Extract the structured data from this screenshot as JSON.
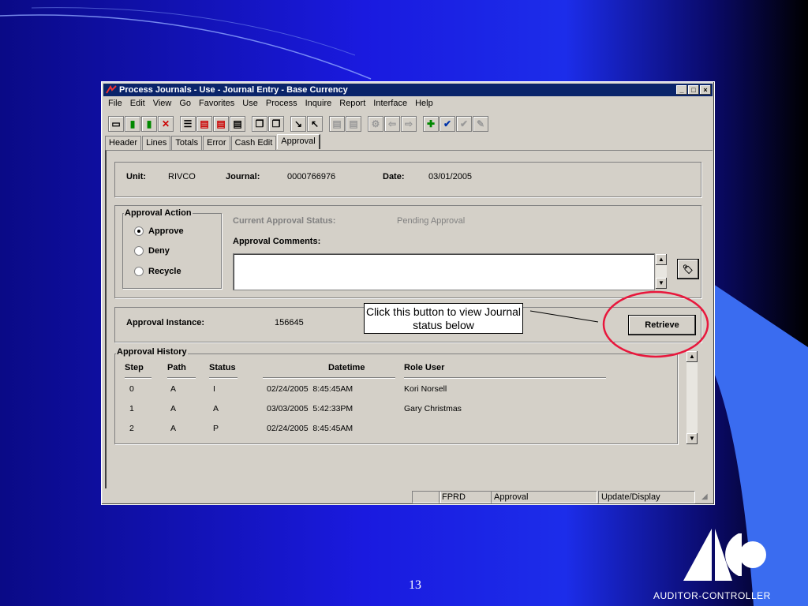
{
  "window": {
    "title": "Process Journals - Use - Journal Entry - Base Currency",
    "controls": [
      "_",
      "□",
      "×"
    ]
  },
  "menu": [
    "File",
    "Edit",
    "View",
    "Go",
    "Favorites",
    "Use",
    "Process",
    "Inquire",
    "Report",
    "Interface",
    "Help"
  ],
  "toolbar_icons": [
    "save-icon",
    "traffic-light-icon",
    "traffic-light-alert-icon",
    "delete-icon",
    "list-icon",
    "insert-row-icon",
    "insert-row-2-icon",
    "page-icon",
    "copy-icon",
    "copy-2-icon",
    "arrow-down-right-icon",
    "arrow-up-left-icon",
    "line-add-icon",
    "line-remove-icon",
    "settings-icon",
    "back-icon",
    "forward-icon",
    "add-icon",
    "check-icon",
    "check-plus-icon",
    "edit-icon"
  ],
  "tabs": [
    "Header",
    "Lines",
    "Totals",
    "Error",
    "Cash Edit",
    "Approval"
  ],
  "active_tab": "Approval",
  "journal": {
    "unit_label": "Unit:",
    "unit_value": "RIVCO",
    "journal_label": "Journal:",
    "journal_value": "0000766976",
    "date_label": "Date:",
    "date_value": "03/01/2005"
  },
  "approval_action": {
    "title": "Approval Action",
    "options": [
      "Approve",
      "Deny",
      "Recycle"
    ],
    "selected": "Approve",
    "status_label": "Current Approval Status:",
    "status_value": "Pending Approval",
    "comments_label": "Approval Comments:",
    "comments_value": ""
  },
  "instance": {
    "label": "Approval Instance:",
    "value": "156645",
    "retrieve_label": "Retrieve"
  },
  "history": {
    "title": "Approval History",
    "columns": [
      "Step",
      "Path",
      "Status",
      "Datetime",
      "Role User"
    ],
    "rows": [
      {
        "step": "0",
        "path": "A",
        "status": "I",
        "datetime": "02/24/2005  8:45:45AM",
        "user": "Kori Norsell"
      },
      {
        "step": "1",
        "path": "A",
        "status": "A",
        "datetime": "03/03/2005  5:42:33PM",
        "user": "Gary Christmas"
      },
      {
        "step": "2",
        "path": "A",
        "status": "P",
        "datetime": "02/24/2005  8:45:45AM",
        "user": ""
      }
    ]
  },
  "statusbar": [
    "",
    "FPRD",
    "Approval",
    "Update/Display"
  ],
  "callout": "Click this button to view Journal status below",
  "slide_number": "13",
  "logo_text": "AUDITOR-CONTROLLER",
  "colors": {
    "title_bar": "#0a246a",
    "highlight_circle": "#e8173c",
    "window_bg": "#d4d0c8"
  }
}
